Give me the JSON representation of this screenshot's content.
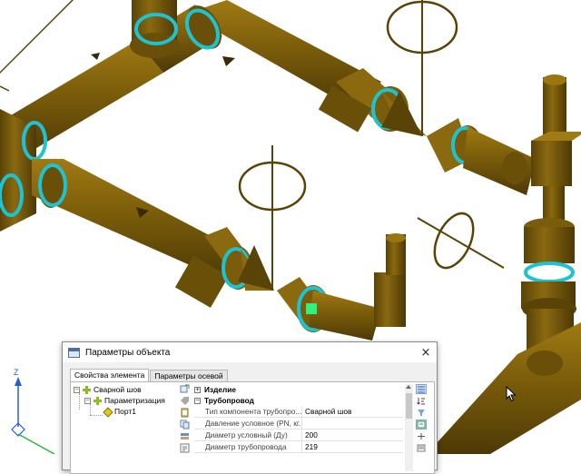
{
  "dialog": {
    "title": "Параметры объекта",
    "close_glyph": "×",
    "tabs": [
      {
        "label": "Свойства элемента",
        "active": true
      },
      {
        "label": "Параметры осевой",
        "active": false
      }
    ],
    "tree": [
      {
        "label": "Сварной шов",
        "icon": "node-icon",
        "expander": "−"
      },
      {
        "label": "Параметризация",
        "icon": "node-icon",
        "expander": "−"
      },
      {
        "label": "Порт1",
        "icon": "port-icon"
      }
    ],
    "grid": {
      "categories": [
        {
          "label": "Изделие",
          "box": "+"
        },
        {
          "label": "Трубопровод",
          "box": "−"
        }
      ],
      "rows": [
        {
          "name": "Тип компонента трубопро...",
          "value": "Сварной шов"
        },
        {
          "name": "Давление условное (PN, кг...",
          "value": ""
        },
        {
          "name": "Диаметр условный (Ду)",
          "value": "200"
        },
        {
          "name": "Диаметр трубопровода",
          "value": "219"
        }
      ]
    }
  },
  "axes": {
    "z_label": "Z"
  },
  "colors": {
    "pipe": "#7a5c0a",
    "pipe_dark": "#4d3906",
    "weld_ring": "#1ec3d2",
    "selection_marker": "#2df27e"
  }
}
